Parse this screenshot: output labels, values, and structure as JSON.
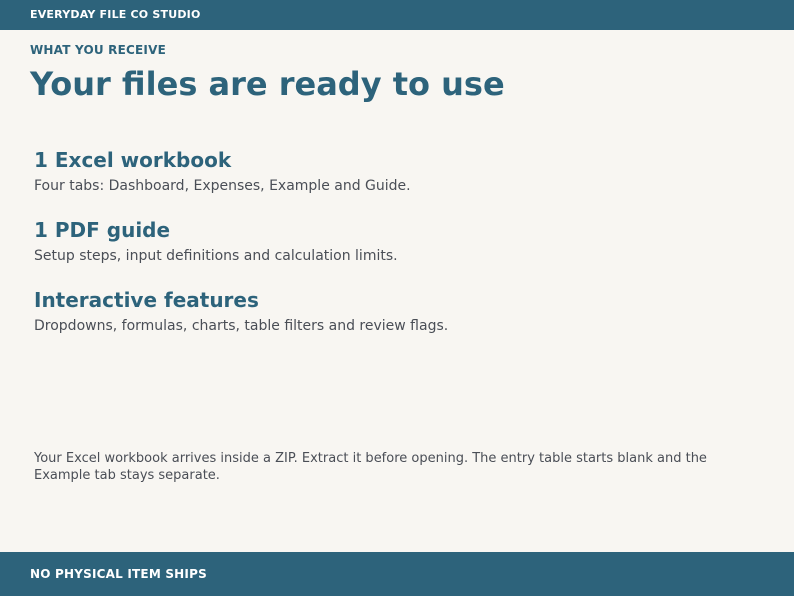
{
  "header": {
    "brand": "EVERYDAY FILE CO STUDIO"
  },
  "hero": {
    "eyebrow": "WHAT YOU RECEIVE",
    "title": "Your files are ready to use"
  },
  "features": [
    {
      "title": "1 Excel workbook",
      "description": "Four tabs: Dashboard, Expenses, Example and Guide."
    },
    {
      "title": "1 PDF guide",
      "description": "Setup steps, input definitions and calculation limits."
    },
    {
      "title": "Interactive features",
      "description": "Dropdowns, formulas, charts, table filters and review flags."
    }
  ],
  "note": "Your Excel workbook arrives inside a ZIP. Extract it before opening. The entry table starts blank and the Example tab stays separate.",
  "footer": {
    "label": "NO PHYSICAL ITEM SHIPS"
  },
  "colors": {
    "brand": "#2d637b",
    "background": "#f8f6f2",
    "body_text": "#4a4e56"
  }
}
